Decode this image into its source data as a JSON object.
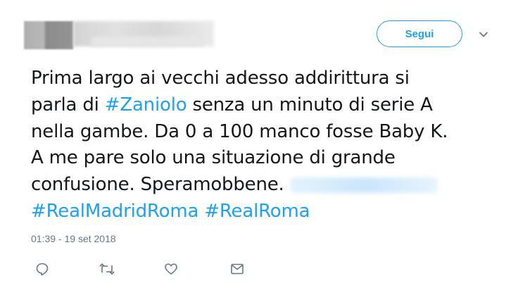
{
  "header": {
    "follow_label": "Segui",
    "menu_icon": "chevron-down-icon"
  },
  "tweet": {
    "lines": [
      [
        "Prima largo ai vecchi adesso addirittura si"
      ],
      [
        "parla di ",
        "#Zaniolo",
        " senza un minuto di serie A"
      ],
      [
        "nella gambe. Da 0 a 100 manco fosse Baby K."
      ],
      [
        "A me pare solo una situazione di grande"
      ],
      [
        "confusione. Speramobbene."
      ],
      [
        "#RealMadridRoma",
        " ",
        "#RealRoma"
      ]
    ],
    "timestamp": "01:39 - 19 set 2018"
  },
  "actions": {
    "icons": [
      "reply-icon",
      "retweet-icon",
      "like-icon",
      "dm-icon"
    ]
  },
  "colors": {
    "accent": "#1da1f2",
    "text": "#14171a",
    "muted": "#657786"
  }
}
